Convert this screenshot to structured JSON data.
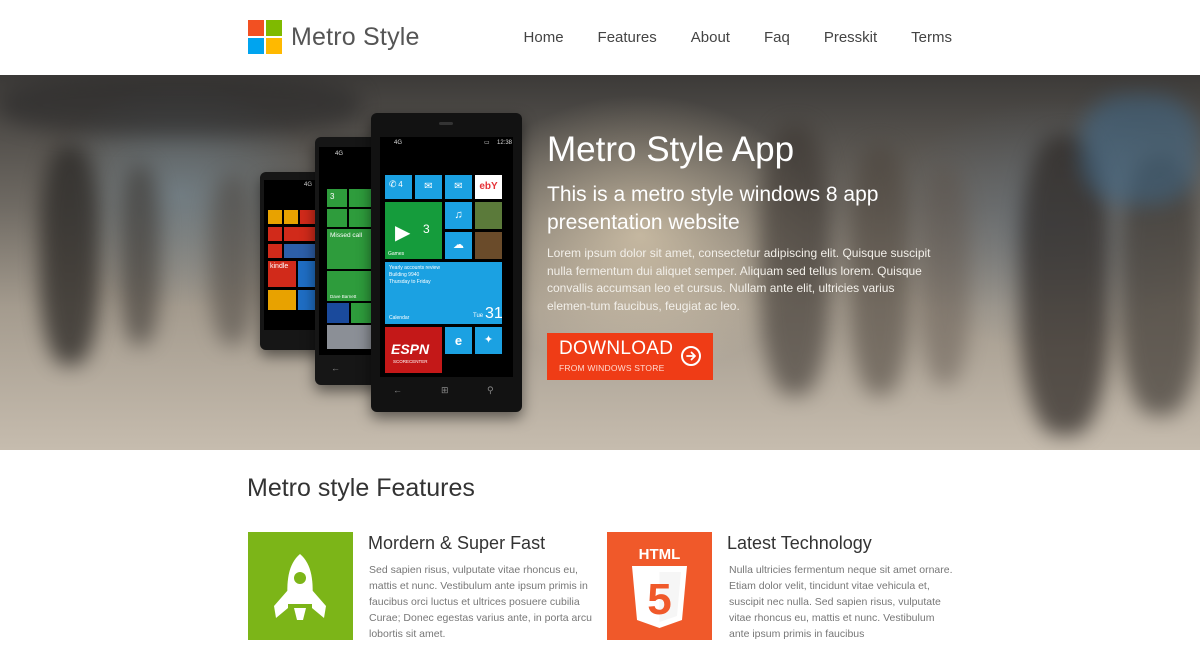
{
  "brand": {
    "name": "Metro Style",
    "logo_colors": [
      "#f25022",
      "#7fba00",
      "#00a4ef",
      "#ffb900"
    ]
  },
  "nav": {
    "items": [
      {
        "label": "Home"
      },
      {
        "label": "Features"
      },
      {
        "label": "About"
      },
      {
        "label": "Faq"
      },
      {
        "label": "Presskit"
      },
      {
        "label": "Terms"
      }
    ]
  },
  "hero": {
    "title": "Metro Style App",
    "subtitle": "This is a metro style windows 8 app presentation website",
    "body": "Lorem ipsum dolor sit amet, consectetur adipiscing elit. Quisque suscipit nulla fermentum dui aliquet semper. Aliquam sed tellus lorem. Quisque convallis accumsan leo et cursus. Nullam ante elit, ultricies varius elemen-tum faucibus, feugiat ac leo.",
    "download_label": "DOWNLOAD",
    "download_sublabel": "FROM WINDOWS STORE",
    "download_color": "#ef3c16"
  },
  "phone_main": {
    "signal": "4G",
    "time": "12:38",
    "tile_phone_count": "4",
    "tile_xbox_count": "3",
    "tile_xbox_label": "Games",
    "calendar_line1": "Yearly accounts review",
    "calendar_line2": "Building 9940",
    "calendar_line3": "Thursday to Friday",
    "calendar_label": "Calendar",
    "calendar_day": "Tue",
    "calendar_date": "31",
    "espn_label": "ESPN",
    "espn_sublabel": "SCORECENTER",
    "ebay_label": "ebY"
  },
  "phone_mid": {
    "signal": "4G",
    "tile_phone_count": "3",
    "missed_call": "Missed call",
    "caller": "Dave Barnett"
  },
  "phone_back": {
    "signal": "4G",
    "kindle_label": "kindle"
  },
  "features": {
    "title": "Metro style Features",
    "items": [
      {
        "heading": "Mordern & Super Fast",
        "text": "Sed sapien risus, vulputate vitae rhoncus eu, mattis et nunc. Vestibulum ante ipsum primis in faucibus orci luctus et ultrices posuere cubilia Curae; Donec egestas varius ante, in porta arcu lobortis sit amet.",
        "icon": "rocket-icon",
        "color": "#7cb518"
      },
      {
        "heading": "Latest Technology",
        "text": "Nulla ultricies fermentum neque sit amet ornare. Etiam dolor velit, tincidunt vitae vehicula et, suscipit nec nulla. Sed sapien risus, vulputate vitae rhoncus eu, mattis et nunc. Vestibulum ante ipsum primis in faucibus",
        "icon": "html5-icon",
        "icon_text": "HTML",
        "icon_number": "5",
        "color": "#f0592a"
      }
    ]
  }
}
